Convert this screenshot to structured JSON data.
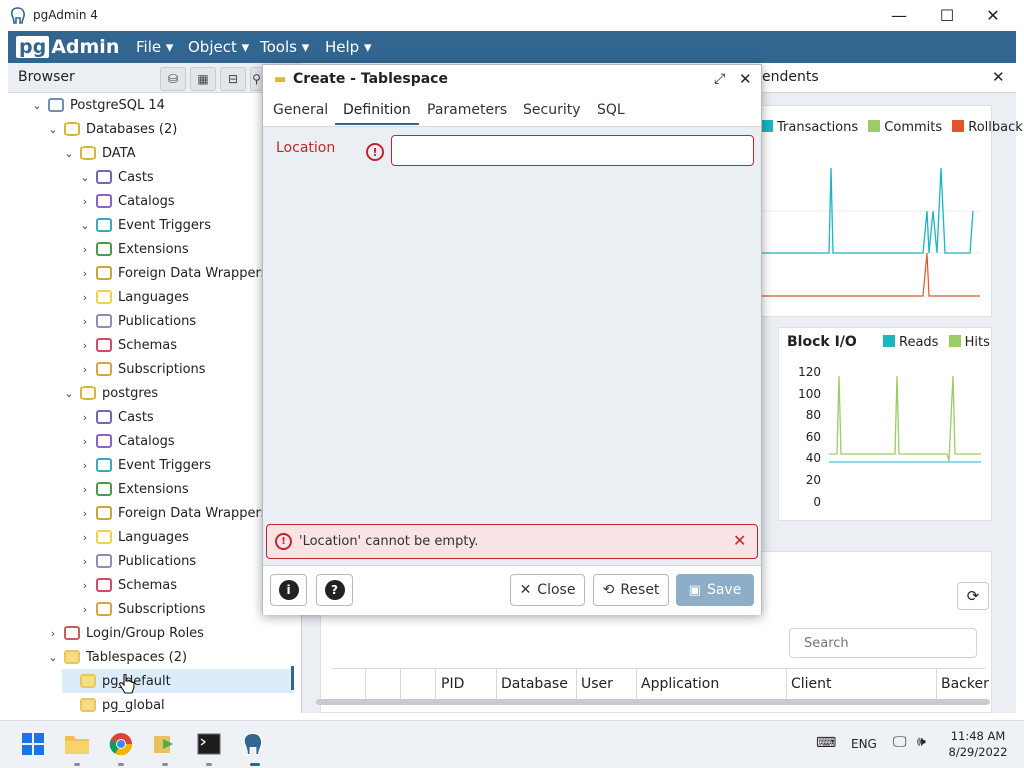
{
  "window": {
    "title": "pgAdmin 4",
    "minimize": "—",
    "maximize": "☐",
    "close": "✕"
  },
  "menubar": {
    "logo_pg": "pg",
    "logo_admin": "Admin",
    "menus": [
      "File ▾",
      "Object ▾",
      "Tools ▾",
      "Help ▾"
    ]
  },
  "browser": {
    "title": "Browser",
    "tree": [
      {
        "label": "PostgreSQL 14",
        "level": 1,
        "chev": "⌄",
        "icon": "elephant-icon"
      },
      {
        "label": "Databases (2)",
        "level": 2,
        "chev": "⌄",
        "icon": "database-icon"
      },
      {
        "label": "DATA",
        "level": 3,
        "chev": "⌄",
        "icon": "database-icon"
      },
      {
        "label": "Casts",
        "level": 4,
        "chev": "⌄",
        "icon": "cast-icon"
      },
      {
        "label": "Catalogs",
        "level": 4,
        "chev": "›",
        "icon": "catalog-icon"
      },
      {
        "label": "Event Triggers",
        "level": 4,
        "chev": "⌄",
        "icon": "event-trigger-icon"
      },
      {
        "label": "Extensions",
        "level": 4,
        "chev": "›",
        "icon": "extension-icon"
      },
      {
        "label": "Foreign Data Wrappers",
        "level": 4,
        "chev": "›",
        "icon": "fdw-icon"
      },
      {
        "label": "Languages",
        "level": 4,
        "chev": "›",
        "icon": "language-icon"
      },
      {
        "label": "Publications",
        "level": 4,
        "chev": "›",
        "icon": "publication-icon"
      },
      {
        "label": "Schemas",
        "level": 4,
        "chev": "›",
        "icon": "schema-icon"
      },
      {
        "label": "Subscriptions",
        "level": 4,
        "chev": "›",
        "icon": "subscription-icon"
      },
      {
        "label": "postgres",
        "level": 3,
        "chev": "⌄",
        "icon": "database-icon"
      },
      {
        "label": "Casts",
        "level": 4,
        "chev": "›",
        "icon": "cast-icon"
      },
      {
        "label": "Catalogs",
        "level": 4,
        "chev": "›",
        "icon": "catalog-icon"
      },
      {
        "label": "Event Triggers",
        "level": 4,
        "chev": "›",
        "icon": "event-trigger-icon"
      },
      {
        "label": "Extensions",
        "level": 4,
        "chev": "›",
        "icon": "extension-icon"
      },
      {
        "label": "Foreign Data Wrappers",
        "level": 4,
        "chev": "›",
        "icon": "fdw-icon"
      },
      {
        "label": "Languages",
        "level": 4,
        "chev": "›",
        "icon": "language-icon"
      },
      {
        "label": "Publications",
        "level": 4,
        "chev": "›",
        "icon": "publication-icon"
      },
      {
        "label": "Schemas",
        "level": 4,
        "chev": "›",
        "icon": "schema-icon"
      },
      {
        "label": "Subscriptions",
        "level": 4,
        "chev": "›",
        "icon": "subscription-icon"
      },
      {
        "label": "Login/Group Roles",
        "level": 2,
        "chev": "›",
        "icon": "roles-icon"
      },
      {
        "label": "Tablespaces (2)",
        "level": 2,
        "chev": "⌄",
        "icon": "folder-icon"
      },
      {
        "label": "pg_default",
        "level": 3,
        "chev": "",
        "icon": "folder-icon",
        "selected": true
      },
      {
        "label": "pg_global",
        "level": 3,
        "chev": "",
        "icon": "folder-icon"
      }
    ]
  },
  "dashboard": {
    "tab_partial": "endents",
    "legend1": [
      "Transactions",
      "Commits",
      "Rollback"
    ],
    "legend_colors": {
      "transactions": "#1bb5c4",
      "commits": "#9ccc65",
      "rollback": "#e0552a",
      "reads": "#1bb5c4",
      "hits": "#9ccc65"
    },
    "blockio": {
      "title": "Block I/O",
      "legend": [
        "Reads",
        "Hits"
      ],
      "ticks": [
        "120",
        "100",
        "80",
        "60",
        "40",
        "20",
        "0"
      ]
    },
    "search_placeholder": "Search",
    "columns": [
      "PID",
      "Database",
      "User",
      "Application",
      "Client",
      "Backer"
    ]
  },
  "dialog": {
    "title": "Create - Tablespace",
    "tabs": [
      "General",
      "Definition",
      "Parameters",
      "Security",
      "SQL"
    ],
    "active_tab": "Definition",
    "location_label": "Location",
    "location_value": "",
    "error_message": "'Location' cannot be empty.",
    "info_icon": "i",
    "help_icon": "?",
    "close_label": "Close",
    "reset_label": "Reset",
    "save_label": "Save"
  },
  "taskbar": {
    "lang": "ENG",
    "time": "11:48 AM",
    "date": "8/29/2022"
  }
}
